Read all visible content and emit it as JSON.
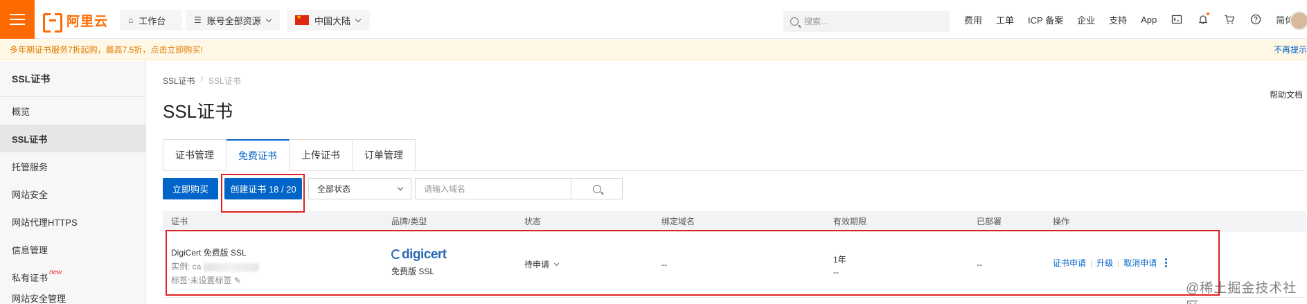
{
  "topbar": {
    "logo_text": "阿里云",
    "workbench": "工作台",
    "resources": "账号全部资源",
    "region": "中国大陆",
    "search_placeholder": "搜索...",
    "links": [
      "费用",
      "工单",
      "ICP 备案",
      "企业",
      "支持",
      "App"
    ],
    "lang": "简体",
    "accent_color": "#ff6a00"
  },
  "banner": {
    "text": "多年期证书服务7折起购，最高7.5折，点击立即购买!",
    "close_text": "不再提示"
  },
  "sidebar": {
    "title": "SSL证书",
    "items": [
      {
        "label": "概览"
      },
      {
        "label": "SSL证书"
      },
      {
        "label": "托管服务"
      },
      {
        "label": "网站安全"
      },
      {
        "label": "网站代理HTTPS"
      },
      {
        "label": "信息管理"
      },
      {
        "label": "私有证书",
        "badge": "new"
      },
      {
        "label": "网站安全管理"
      }
    ]
  },
  "page": {
    "breadcrumb": [
      "SSL证书",
      "SSL证书"
    ],
    "title": "SSL证书",
    "help": "帮助文档"
  },
  "tabs": [
    "证书管理",
    "免费证书",
    "上传证书",
    "订单管理"
  ],
  "toolbar": {
    "buy_label": "立即购买",
    "create_label": "创建证书 18 / 20",
    "status_select": "全部状态",
    "domain_placeholder": "请输入域名"
  },
  "table": {
    "columns": [
      "证书",
      "品牌/类型",
      "状态",
      "绑定域名",
      "有效期限",
      "已部署",
      "操作"
    ],
    "rows": [
      {
        "cert_name": "DigiCert 免费版 SSL",
        "instance_prefix": "实例: ca",
        "tag_text": "标签:未设置标签",
        "brand_logo": "digicert",
        "brand_type": "免费版 SSL",
        "status": "待申请",
        "domain": "--",
        "validity": "1年",
        "validity_sub": "--",
        "deployed": "--",
        "actions": [
          "证书申请",
          "升级",
          "取消申请"
        ]
      }
    ]
  },
  "watermark": "@稀土掘金技术社区"
}
